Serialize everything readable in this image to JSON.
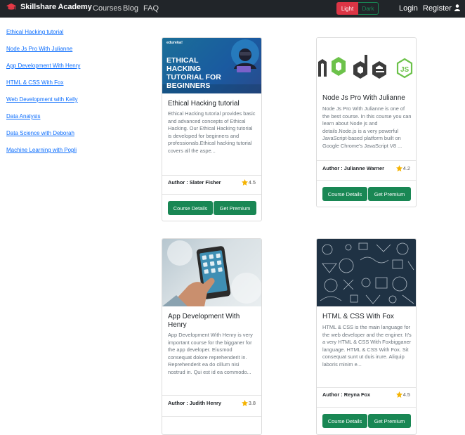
{
  "navbar": {
    "brand": "Skillshare Academy",
    "links": [
      "Courses",
      "Blog",
      "FAQ"
    ],
    "theme_light": "Light",
    "theme_dark": "Dark",
    "login": "Login",
    "register": "Register"
  },
  "sidebar": {
    "items": [
      "Ethical Hacking tutorial",
      "Node Js Pro With Julianne",
      "App Development With Henry",
      "HTML & CSS With Fox",
      "Web Development with Kelly",
      "Data Analysis",
      "Data Science with Deborah",
      "Machine Learning with Popli"
    ]
  },
  "cards": [
    {
      "image_brand": "edureka!",
      "image_title": [
        "ETHICAL",
        "HACKING",
        "TUTORIAL FOR",
        "BEGINNERS"
      ],
      "title": "Ethical Hacking tutorial",
      "desc": "Ethical Hacking tutorial provides basic and advanced concepts of Ethical Hacking. Our Ethical Hacking tutorial is developed for beginners and professionals.Ethical hacking tutorial covers all the aspe...",
      "author": "Author : Slater Fisher",
      "rating": "4.5"
    },
    {
      "title": "Node Js Pro With Julianne",
      "desc": "Node Js Pro With Julianne is one of the best course. In this course you can learn about Node js and details.Node.js is a very powerful JavaScript-based platform built on Google Chrome's JavaScript V8 ...",
      "author": "Author : Julianne Warner",
      "rating": "4.2"
    },
    {
      "title": "App Development With Henry",
      "desc": "App Development With Henry is very important course for the bigganer for the app developer. Eiusmod consequat dolore reprehenderit in. Reprehenderit ea do cillum nisi nostrud in. Qui est id ea commodo...",
      "author": "Author : Judith Henry",
      "rating": "3.8"
    },
    {
      "title": "HTML & CSS With Fox",
      "desc": "HTML & CSS is the main language for the web developer and the enginer. It's a very HTML & CSS With Foxbigganer language. HTML & CSS With Fox. Sit consequat sunt ut duis irure. Aliquip laboris minim e...",
      "author": "Author : Reyna Fox",
      "rating": "4.5"
    }
  ],
  "buttons": {
    "details": "Course Details",
    "premium": "Get Premium"
  },
  "colors": {
    "navbar_bg": "#212529",
    "btn_green": "#198754",
    "btn_red": "#dc3545",
    "link_blue": "#0d6efd",
    "star": "#f5b301"
  }
}
